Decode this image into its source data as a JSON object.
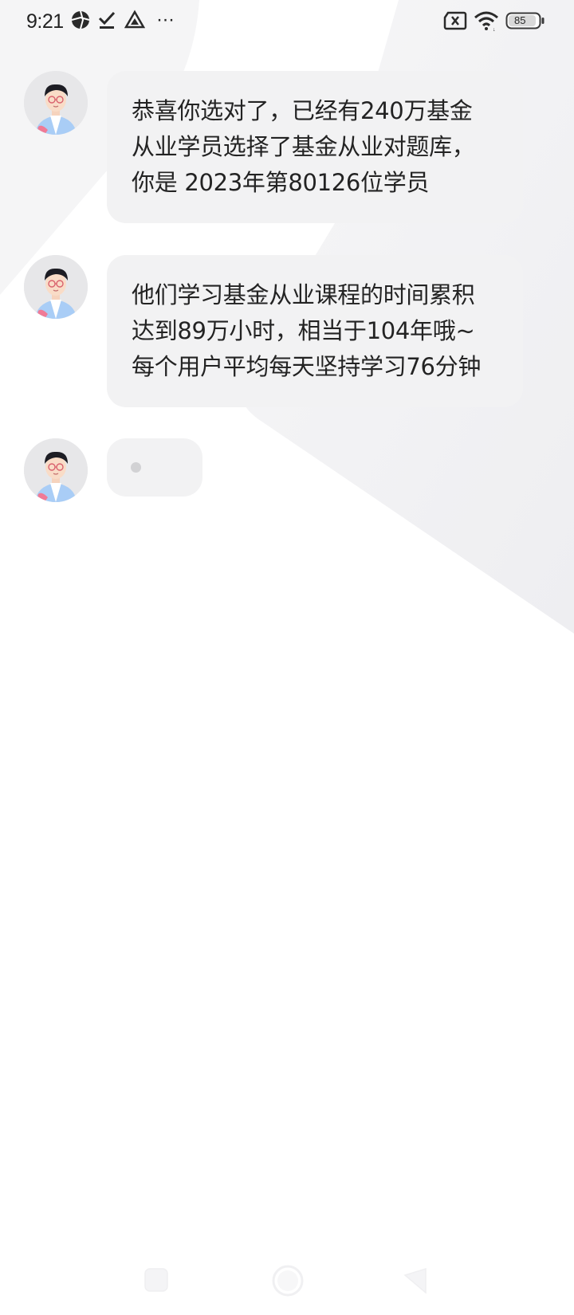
{
  "status_bar": {
    "time": "9:21",
    "more": "···",
    "battery": "85",
    "icons": [
      "aperture-icon",
      "check-download-icon",
      "drive-icon",
      "sim-none-icon",
      "wifi-icon",
      "battery-icon"
    ]
  },
  "chat": {
    "messages": [
      {
        "text": "恭喜你选对了，已经有240万基金\n从业学员选择了基金从业对题库，\n你是 2023年第80126位学员"
      },
      {
        "text": "他们学习基金从业课程的时间累积\n达到89万小时，相当于104年哦~\n每个用户平均每天坚持学习76分钟"
      }
    ],
    "typing": true
  },
  "nav_bar": {
    "icons": [
      "recents-square-icon",
      "home-circle-icon",
      "back-triangle-icon"
    ]
  },
  "colors": {
    "bubble": "#f2f2f3",
    "background_shape": "#f3f3f5",
    "text": "#232323"
  }
}
